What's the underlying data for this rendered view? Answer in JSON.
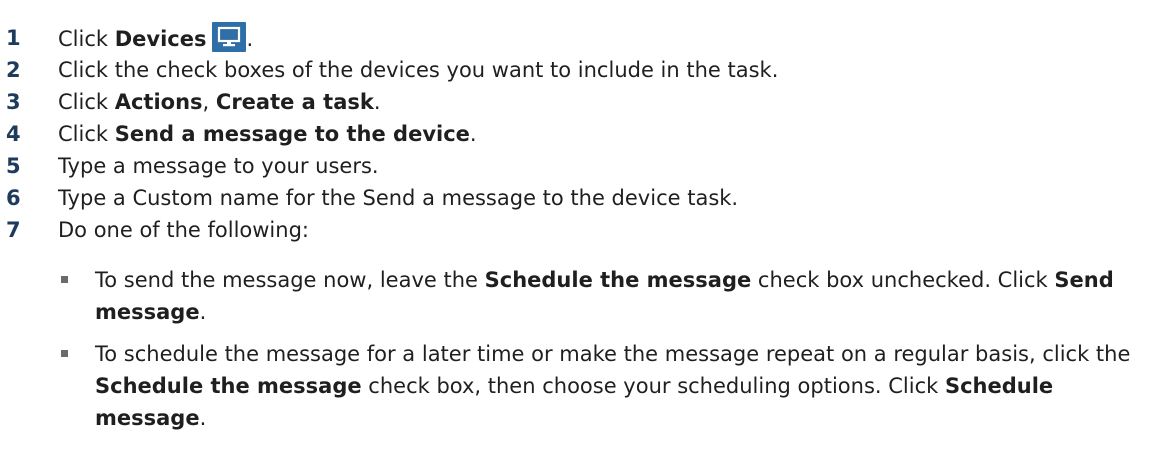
{
  "steps": [
    {
      "num": "1",
      "pre": "Click ",
      "bold": "Devices",
      "icon": "monitor-icon",
      "post": "."
    },
    {
      "num": "2",
      "text": "Click the check boxes of the devices you want to include in the task."
    },
    {
      "num": "3",
      "pre": "Click ",
      "bold1": "Actions",
      "mid": ", ",
      "bold2": "Create a task",
      "post": "."
    },
    {
      "num": "4",
      "pre": "Click ",
      "bold": "Send a message to the device",
      "post": "."
    },
    {
      "num": "5",
      "text": "Type a message to your users."
    },
    {
      "num": "6",
      "text": "Type a Custom name for the Send a message to the device task."
    },
    {
      "num": "7",
      "text": "Do one of the following:"
    }
  ],
  "bullets": [
    {
      "a": "To send the message now, leave the ",
      "b1": "Schedule the message",
      "c": " check box unchecked. Click ",
      "b2": "Send message",
      "d": "."
    },
    {
      "a": "To schedule the message for a later time or make the message repeat on a regular basis, click the ",
      "b1": "Schedule the message",
      "c": " check box, then choose your scheduling options. Click ",
      "b2": "Schedule message",
      "d": "."
    }
  ],
  "colors": {
    "number": "#1f3b5c",
    "icon_bg": "#2f6fa8",
    "bullet": "#6b6b6b"
  }
}
